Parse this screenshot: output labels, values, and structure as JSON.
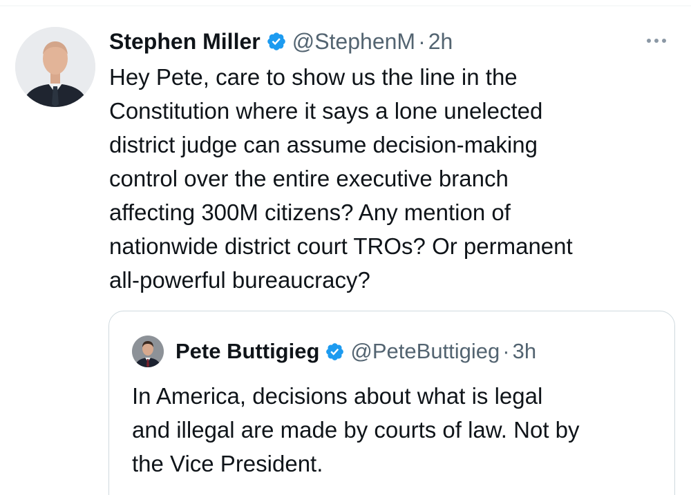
{
  "tweet": {
    "author_name": "Stephen Miller",
    "handle": "@StephenM",
    "separator": "·",
    "time": "2h",
    "text": "Hey Pete, care to show us the line in the\nConstitution where it says a lone unelected\ndistrict judge can assume decision-making\ncontrol over the entire executive branch\naffecting 300M citizens? Any mention of\nnationwide district court TROs? Or permanent\nall-powerful bureaucracy?",
    "verified_icon": "verified-badge-icon",
    "more_icon": "more-options-icon"
  },
  "quoted": {
    "author_name": "Pete Buttigieg",
    "handle": "@PeteButtigieg",
    "separator": "·",
    "time": "3h",
    "text": "In America, decisions about what is legal\nand illegal are made by courts of law. Not by\nthe Vice President.",
    "verified_icon": "verified-badge-icon"
  },
  "colors": {
    "verified_blue": "#1d9bf0",
    "secondary_text": "#536471",
    "border": "#cfd9de"
  }
}
